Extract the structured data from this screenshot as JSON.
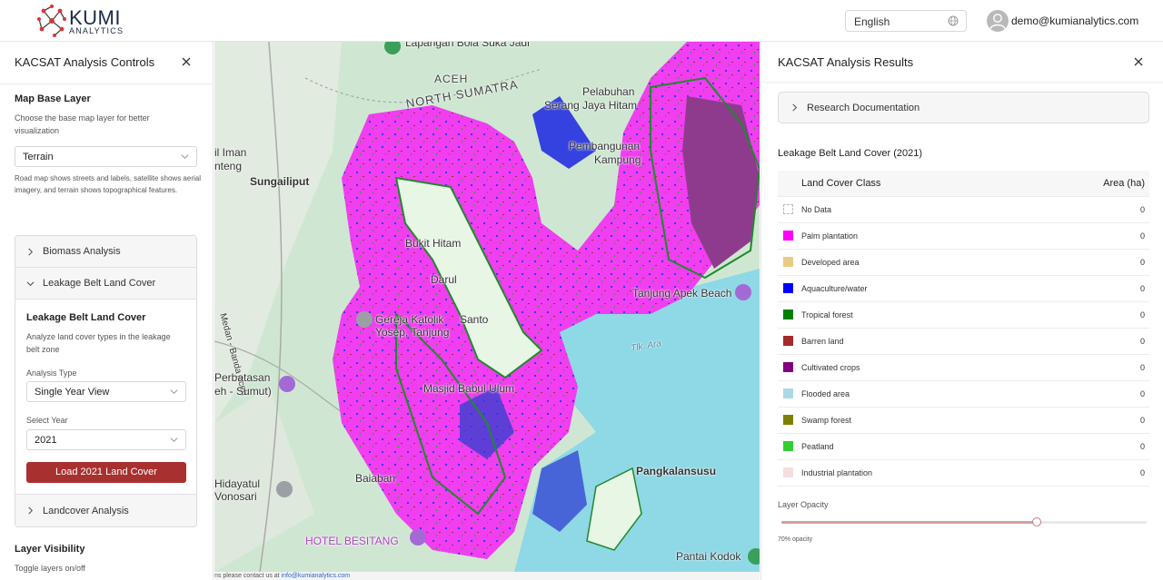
{
  "header": {
    "logo_main": "KUMI",
    "logo_sub": "ANALYTICS",
    "language": "English",
    "user_email": "demo@kumianalytics.com"
  },
  "left_panel": {
    "title": "KACSAT Analysis Controls",
    "base_layer": {
      "title": "Map Base Layer",
      "description": "Choose the base map layer for better visualization",
      "selected": "Terrain",
      "help": "Road map shows streets and labels, satellite shows aerial imagery, and terrain shows topographical features."
    },
    "accordion": {
      "biomass": "Biomass Analysis",
      "leakage": "Leakage Belt Land Cover",
      "landcover": "Landcover Analysis"
    },
    "leakage_section": {
      "title": "Leakage Belt Land Cover",
      "description": "Analyze land cover types in the leakage belt zone",
      "analysis_type_label": "Analysis Type",
      "analysis_type_value": "Single Year View",
      "year_label": "Select Year",
      "year_value": "2021",
      "load_button": "Load 2021 Land Cover"
    },
    "layer_visibility": {
      "title": "Layer Visibility",
      "description": "Toggle layers on/off"
    }
  },
  "map": {
    "labels": {
      "lapangan": "Lapangan Bola Suka Jadi",
      "aceh": "ACEH",
      "north_sumatra": "NORTH SUMATRA",
      "pelabuhan": "Pelabuhan",
      "serang": "Serang Jaya Hitam",
      "pembangunan": "Pembangunan",
      "kampung": "Kampung",
      "iman": "il Iman",
      "nteng": "nteng",
      "sungailiput": "Sungailiput",
      "bukit": "Bukit Hitam",
      "darul": "Darul",
      "tanjung_apek": "Tanjung Apek Beach",
      "gereja": "Gereja Katolik",
      "yosep": "Yosep, Tanjung",
      "santo": "Santo",
      "medan": "Medan - Banda Aceh",
      "perbatasan": "Perbatasan",
      "sumut": "eh - Sumut)",
      "masjid": "Masjid Babul Ulum",
      "tlk_ara": "Tlk. Ara",
      "baiaban": "Baiaban",
      "hidayatul": "Hidayatul",
      "vonosari": "Vonosari",
      "pangkalansusu": "Pangkalansusu",
      "hotel": "HOTEL BESITANG",
      "pantai": "Pantai Kodok"
    },
    "attribution_text": "ns please contact us at ",
    "attribution_link": "info@kumianalytics.com"
  },
  "right_panel": {
    "title": "KACSAT Analysis Results",
    "research_doc": "Research Documentation",
    "table_title": "Leakage Belt Land Cover (2021)",
    "columns": [
      "Land Cover Class",
      "Area (ha)"
    ],
    "rows": [
      {
        "name": "No Data",
        "value": "0",
        "color": "#ffffff"
      },
      {
        "name": "Palm plantation",
        "value": "0",
        "color": "#ff00ff"
      },
      {
        "name": "Developed area",
        "value": "0",
        "color": "#e8cc84"
      },
      {
        "name": "Aquaculture/water",
        "value": "0",
        "color": "#0000ff"
      },
      {
        "name": "Tropical forest",
        "value": "0",
        "color": "#008000"
      },
      {
        "name": "Barren land",
        "value": "0",
        "color": "#a52a2a"
      },
      {
        "name": "Cultivated crops",
        "value": "0",
        "color": "#800080"
      },
      {
        "name": "Flooded area",
        "value": "0",
        "color": "#add8e6"
      },
      {
        "name": "Swamp forest",
        "value": "0",
        "color": "#808000"
      },
      {
        "name": "Peatland",
        "value": "0",
        "color": "#32cd32"
      },
      {
        "name": "Industrial plantation",
        "value": "0",
        "color": "#f5dede"
      }
    ],
    "opacity_label": "Layer Opacity",
    "opacity_value": 0.7,
    "opacity_text": "70% opacity"
  },
  "colors": {
    "accent": "#a8302f",
    "palm": "#ff00ff",
    "water": "#8fd8e6"
  }
}
